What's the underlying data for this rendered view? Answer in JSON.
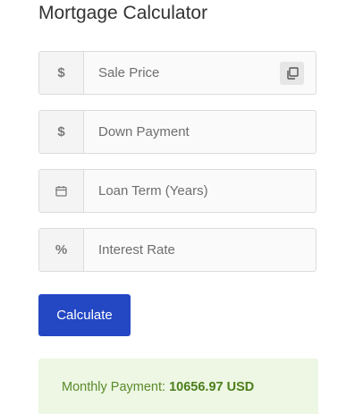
{
  "title": "Mortgage Calculator",
  "fields": [
    {
      "name": "sale-price",
      "addon": "$",
      "icon": "dollar-icon",
      "placeholder": "Sale Price"
    },
    {
      "name": "down-payment",
      "addon": "$",
      "icon": "dollar-icon",
      "placeholder": "Down Payment"
    },
    {
      "name": "loan-term",
      "addon": "",
      "icon": "calendar-icon",
      "placeholder": "Loan Term (Years)"
    },
    {
      "name": "interest-rate",
      "addon": "%",
      "icon": "percent-icon",
      "placeholder": "Interest Rate"
    }
  ],
  "copy_icon": "copy-icon",
  "calculate_label": "Calculate",
  "result": {
    "label": "Monthly Payment:",
    "amount": "10656.97 USD"
  },
  "colors": {
    "button": "#2447c4",
    "result_bg": "#edf7e3",
    "result_text": "#5a8a2a"
  }
}
